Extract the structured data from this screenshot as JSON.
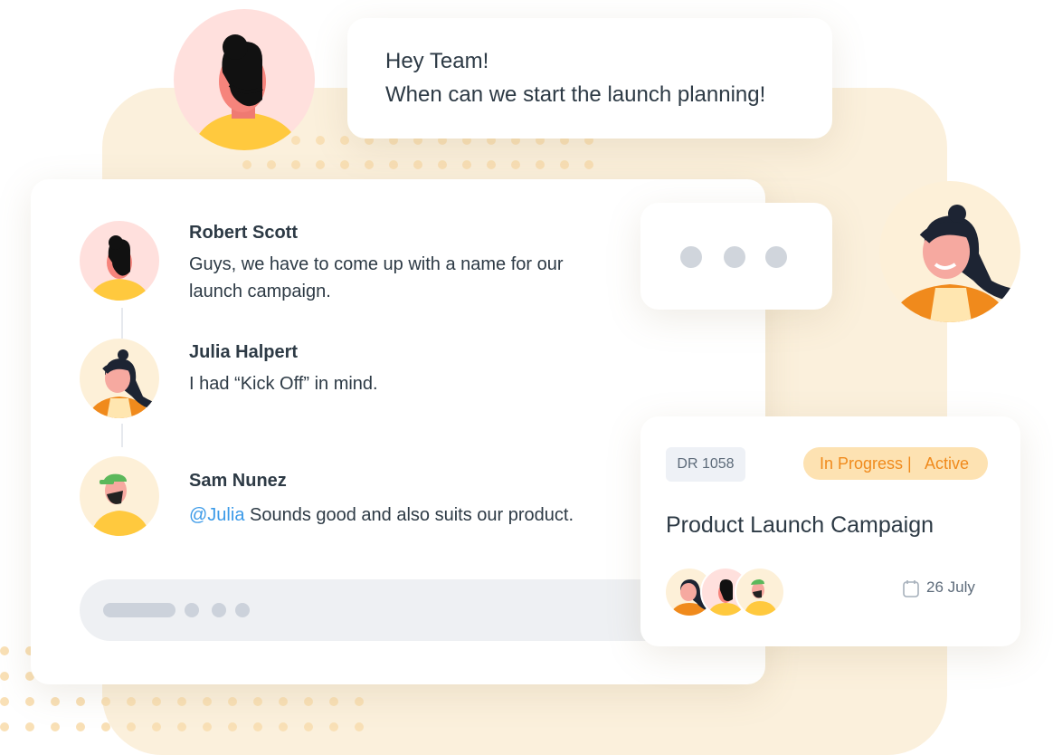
{
  "bubble": {
    "line1": "Hey Team!",
    "line2": "When can we start the launch planning!"
  },
  "chat": {
    "messages": [
      {
        "name": "Robert Scott",
        "line1": "Guys, we have to come up with a name for our",
        "line2": "launch campaign.",
        "avatar": "bearded-man-avatar"
      },
      {
        "name": "Julia Halpert",
        "text": "I had “Kick Off” in mind.",
        "avatar": "woman-bun-avatar"
      },
      {
        "name": "Sam Nunez",
        "mention": "@Julia",
        "text": " Sounds good and also suits our product.",
        "avatar": "man-cap-avatar"
      }
    ]
  },
  "task": {
    "id": "DR 1058",
    "status_progress": "In Progress |",
    "status_active": "Active",
    "title": "Product Launch Campaign",
    "date": "26 July",
    "date_icon": "calendar-icon"
  },
  "colors": {
    "panel": "#fbf0dc",
    "accent_orange": "#f08a1c",
    "mention_blue": "#3b9ae8",
    "badge_bg": "#fde2b2"
  }
}
